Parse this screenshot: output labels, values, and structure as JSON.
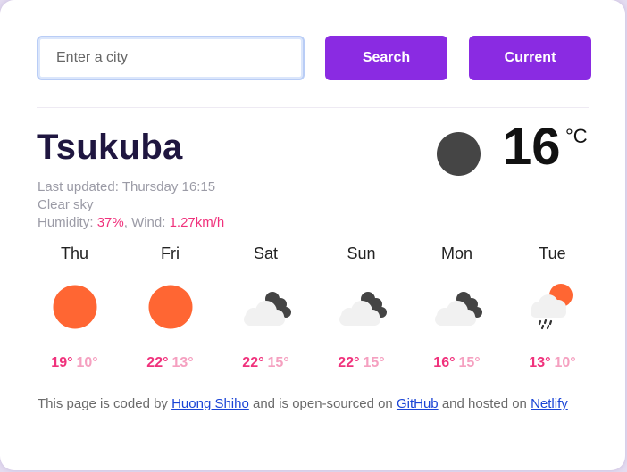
{
  "search": {
    "placeholder": "Enter a city",
    "value": ""
  },
  "buttons": {
    "search_label": "Search",
    "current_label": "Current"
  },
  "current": {
    "city": "Tsukuba",
    "last_updated_label": "Last updated:",
    "last_updated": "Thursday 16:15",
    "description": "Clear sky",
    "humidity_label": "Humidity:",
    "humidity": "37%",
    "wind_label": "Wind:",
    "wind": "1.27km/h",
    "temperature": "16",
    "unit": "°C",
    "icon": "clear-night-icon"
  },
  "forecast": [
    {
      "day": "Thu",
      "high": "19°",
      "low": "10°",
      "icon": "sun-icon"
    },
    {
      "day": "Fri",
      "high": "22°",
      "low": "13°",
      "icon": "sun-icon"
    },
    {
      "day": "Sat",
      "high": "22°",
      "low": "15°",
      "icon": "cloudy-icon"
    },
    {
      "day": "Sun",
      "high": "22°",
      "low": "15°",
      "icon": "cloudy-icon"
    },
    {
      "day": "Mon",
      "high": "16°",
      "low": "15°",
      "icon": "cloudy-icon"
    },
    {
      "day": "Tue",
      "high": "13°",
      "low": "10°",
      "icon": "rain-sun-icon"
    }
  ],
  "footer": {
    "text1": "This page is coded by",
    "author": "Huong Shiho",
    "text2": "and is open-sourced on",
    "github": "GitHub",
    "text3": "and hosted on",
    "netlify": "Netlify"
  },
  "colors": {
    "accent": "#8a2be2",
    "highlight": "#f0327c",
    "low_temp": "#f5a0c0",
    "sun": "#ff6633"
  }
}
